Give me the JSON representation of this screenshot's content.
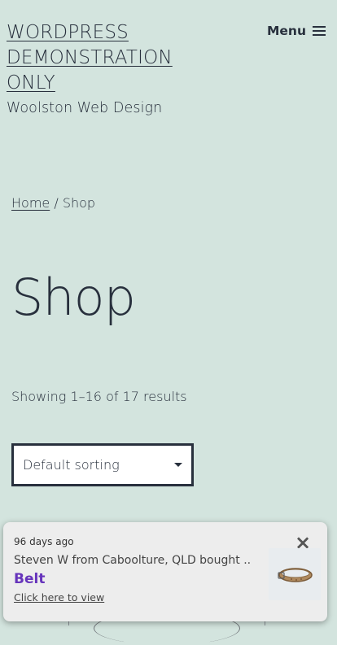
{
  "header": {
    "site_title_lines": [
      "WORDPRESS",
      "DEMONSTRATION",
      "ONLY"
    ],
    "tagline": "Woolston Web Design",
    "menu_label": "Menu"
  },
  "breadcrumb": {
    "home": "Home",
    "separator": " / ",
    "current": "Shop"
  },
  "page_title": "Shop",
  "result_count": "Showing 1–16 of 17 results",
  "sorting": {
    "selected": "Default sorting"
  },
  "sales_notice": {
    "time_ago": "96 days ago",
    "message": "Steven W from Caboolture, QLD bought ...",
    "product": "Belt",
    "link": "Click here to view",
    "close_icon": "close-icon",
    "product_color": "#6634bb"
  },
  "colors": {
    "background": "#d3e4de",
    "text": "#28303d"
  }
}
